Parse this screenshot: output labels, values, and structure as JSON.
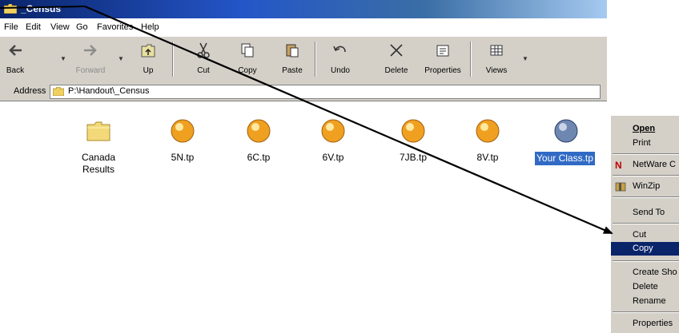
{
  "window": {
    "title": "_Census"
  },
  "menu": [
    "File",
    "Edit",
    "View",
    "Go",
    "Favorites",
    "Help"
  ],
  "toolbar": {
    "back": "Back",
    "forward": "Forward",
    "up": "Up",
    "cut": "Cut",
    "copy": "Copy",
    "paste": "Paste",
    "undo": "Undo",
    "delete": "Delete",
    "properties": "Properties",
    "views": "Views"
  },
  "address": {
    "label": "Address",
    "path": "P:\\Handout\\_Census"
  },
  "files": [
    {
      "name": "Canada",
      "name2": "Results",
      "icon": "folder-icon"
    },
    {
      "name": "5N.tp",
      "icon": "teacherplus-file-icon"
    },
    {
      "name": "6C.tp",
      "icon": "teacherplus-file-icon"
    },
    {
      "name": "6V.tp",
      "icon": "teacherplus-file-icon"
    },
    {
      "name": "7JB.tp",
      "icon": "teacherplus-file-icon"
    },
    {
      "name": "8V.tp",
      "icon": "teacherplus-file-icon"
    },
    {
      "name": "Your Class.tp",
      "icon": "teacherplus-file-icon",
      "selected": true
    }
  ],
  "context_menu": {
    "open": "Open",
    "print": "Print",
    "netware": "NetWare C",
    "winzip": "WinZip",
    "send_to": "Send To",
    "cut": "Cut",
    "copy": "Copy",
    "create_shortcut": "Create Sho",
    "delete": "Delete",
    "rename": "Rename",
    "properties": "Properties"
  },
  "colors": {
    "title_bar": "#0a246a",
    "selection": "#316ac5",
    "menu_highlight": "#0a246a",
    "toolbar": "#d4d0c8"
  }
}
